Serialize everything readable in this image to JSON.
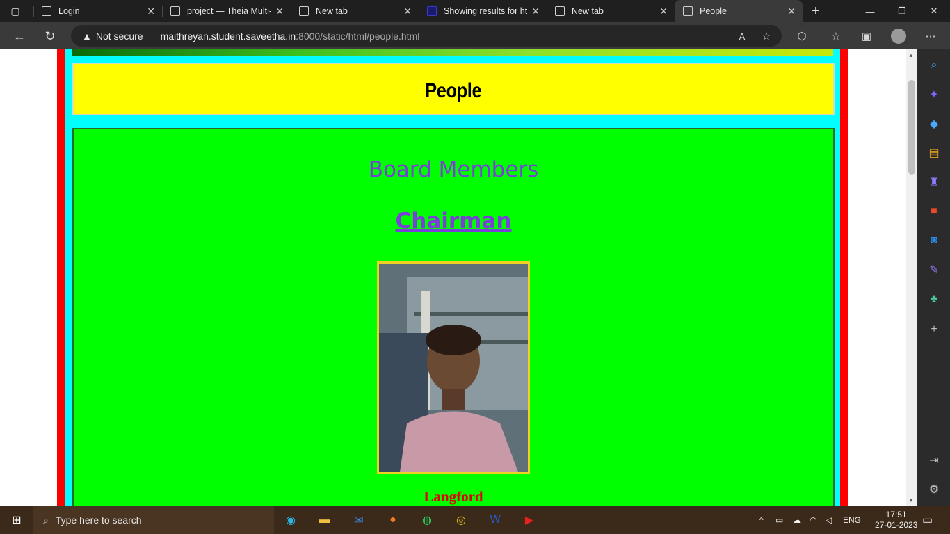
{
  "browser": {
    "tabs": [
      {
        "label": "Login"
      },
      {
        "label": "project — Theia Multi-"
      },
      {
        "label": "New tab"
      },
      {
        "label": "Showing results for htt"
      },
      {
        "label": "New tab"
      },
      {
        "label": "People"
      }
    ],
    "active_tab": 5,
    "address": {
      "security": "Not secure",
      "host": "maithreyan.student.saveetha.in",
      "path": ":8000/static/html/people.html"
    }
  },
  "page": {
    "title": "People",
    "section_title": "Board Members",
    "role": "Chairman",
    "member_name": "Langford"
  },
  "taskbar": {
    "search_placeholder": "Type here to search",
    "language": "ENG",
    "time": "17:51",
    "date": "27-01-2023"
  },
  "colors": {
    "page_frame": "#ff0000",
    "inner_frame": "#00ffff",
    "header_bg": "#ffff00",
    "main_bg": "#00ff00",
    "heading_color": "#7a3fd8",
    "name_color": "#e00000"
  }
}
